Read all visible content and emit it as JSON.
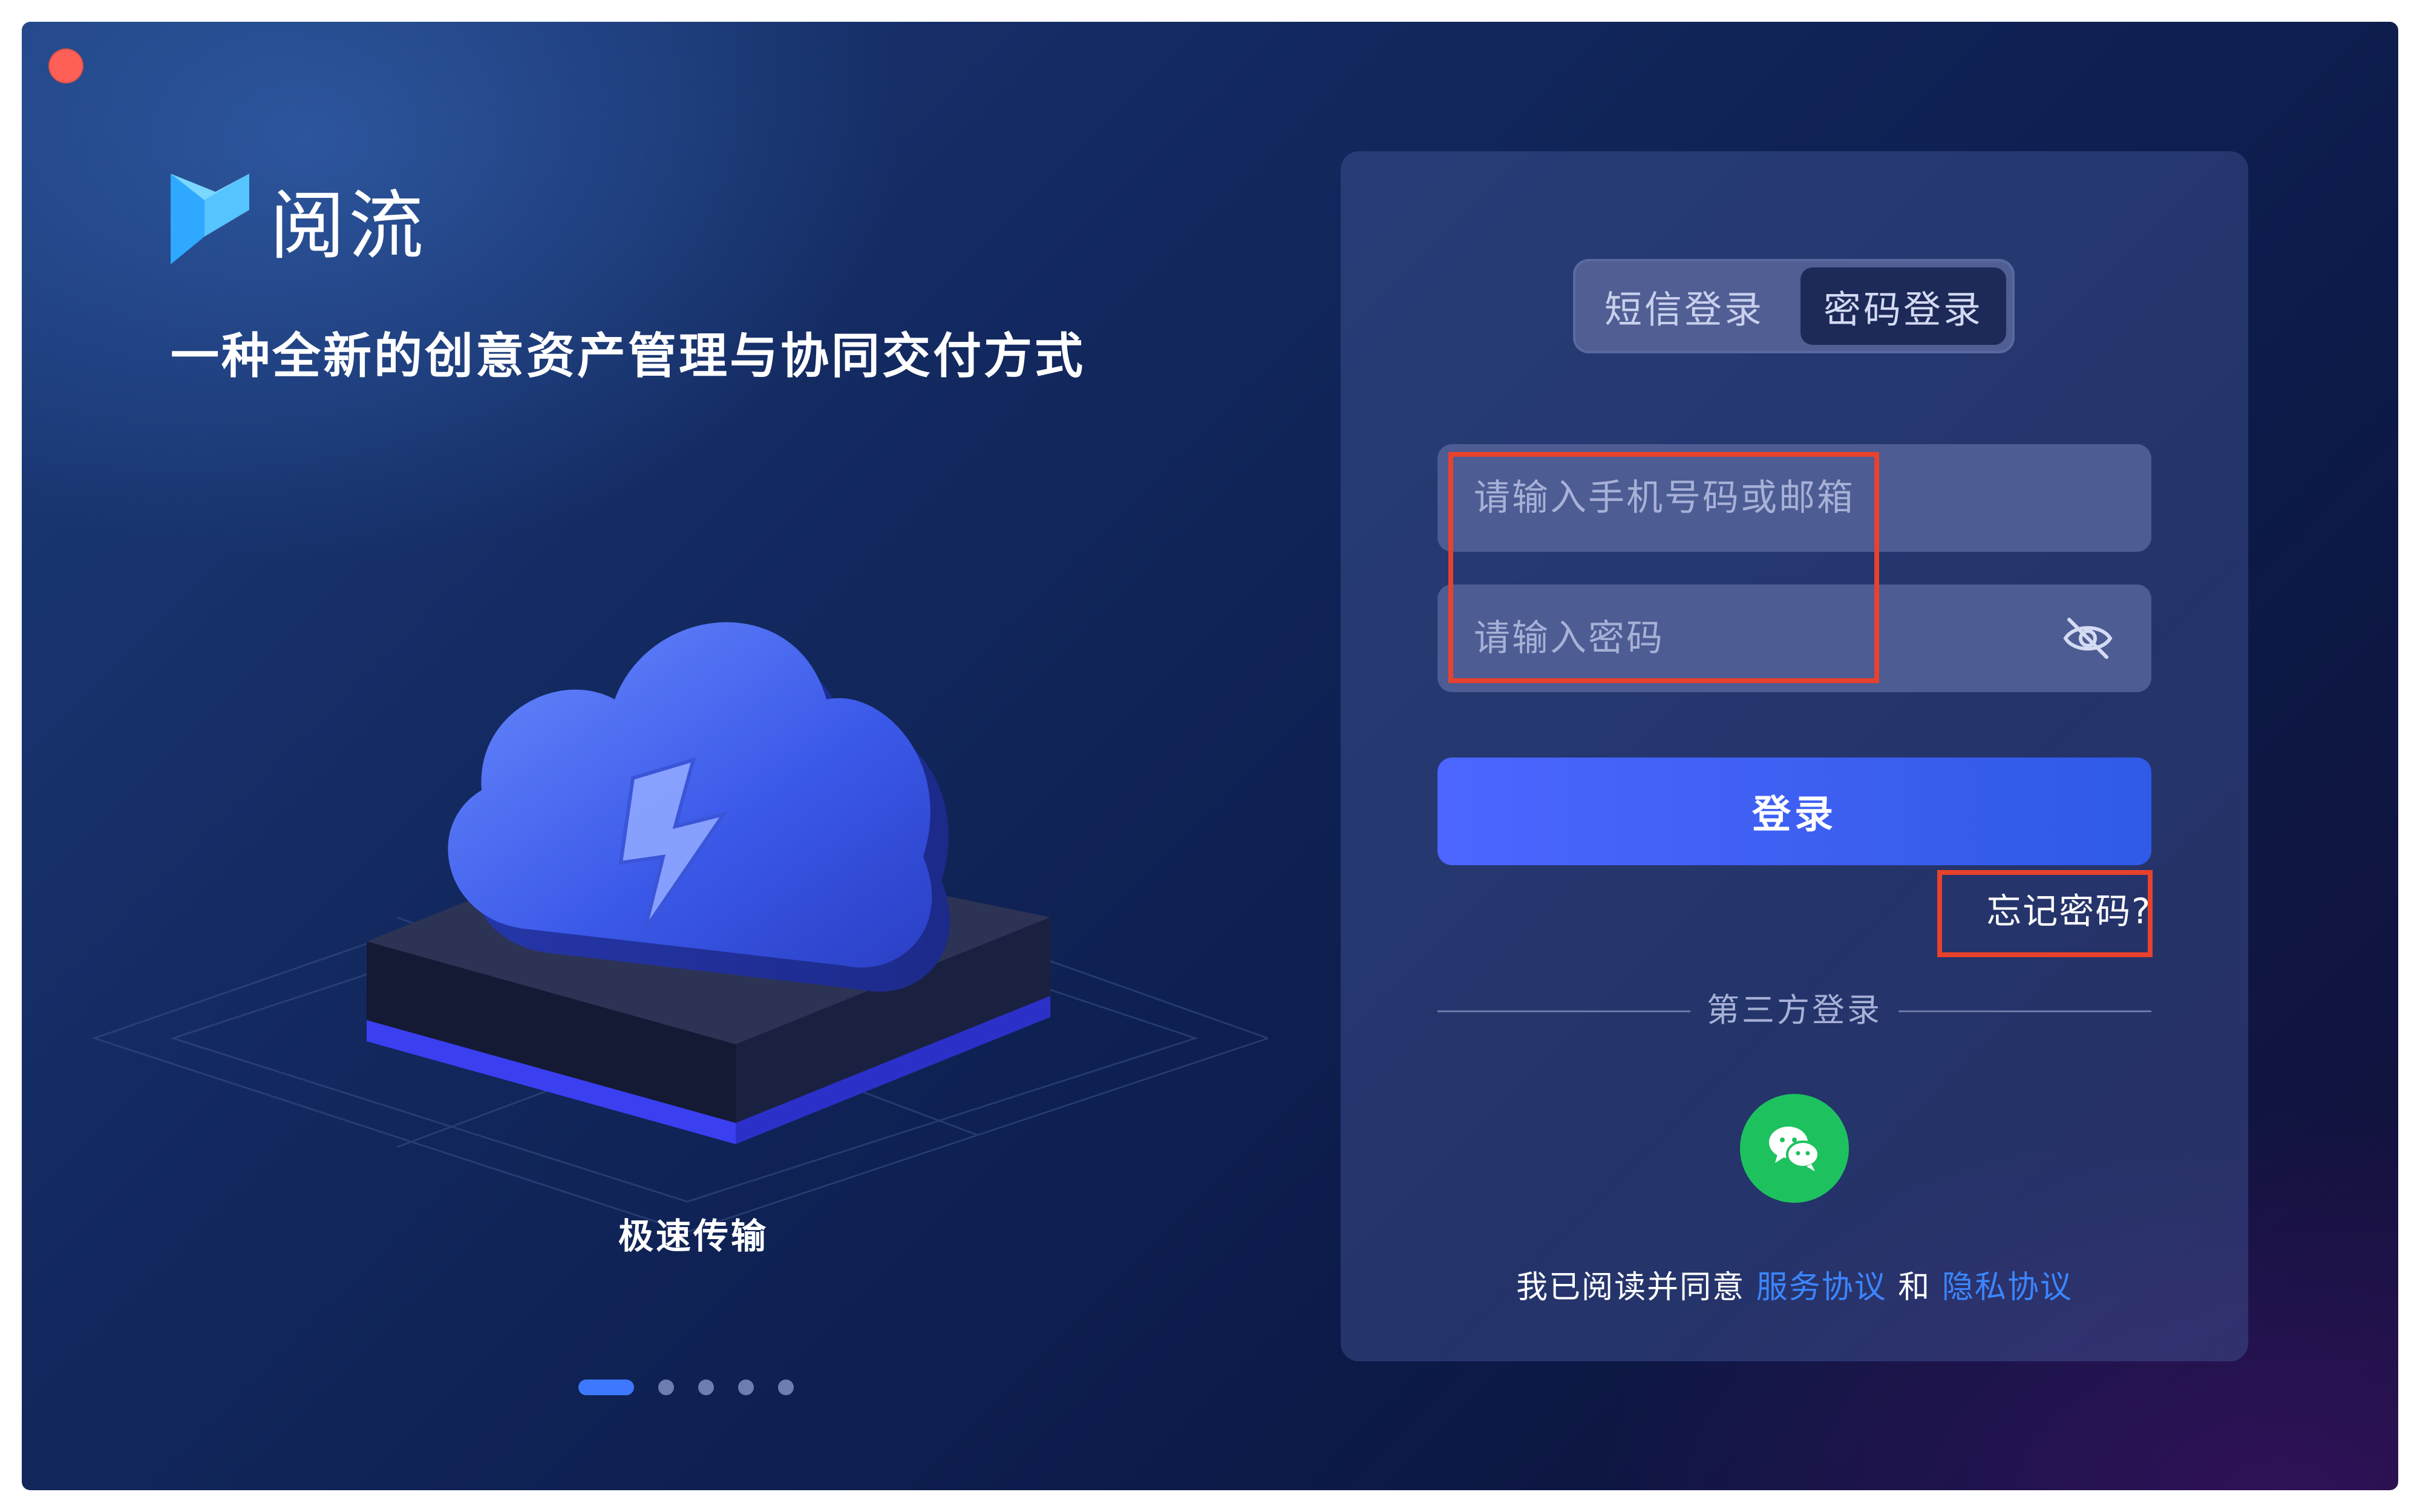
{
  "app": {
    "name": "阅流",
    "tagline": "一种全新的创意资产管理与协同交付方式"
  },
  "carousel": {
    "caption": "极速传输",
    "count": 5,
    "active_index": 0
  },
  "login": {
    "tabs": [
      {
        "label": "短信登录",
        "active": false
      },
      {
        "label": "密码登录",
        "active": true
      }
    ],
    "account_placeholder": "请输入手机号码或邮箱",
    "password_placeholder": "请输入密码",
    "submit_label": "登录",
    "forgot_label": "忘记密码?",
    "third_party_label": "第三方登录",
    "agreement": {
      "prefix": "我已阅读并同意",
      "service_link": "服务协议",
      "and": "和",
      "privacy_link": "隐私协议"
    }
  },
  "icons": {
    "close": "traffic-close",
    "logo": "flow-logo",
    "eye": "eye-off-icon",
    "social": "wechat-icon"
  },
  "colors": {
    "accent": "#3b5ef0",
    "link": "#3b86ff",
    "wechat": "#1dc25f",
    "annotation": "#e8412c",
    "close_button": "#fe5f57"
  }
}
